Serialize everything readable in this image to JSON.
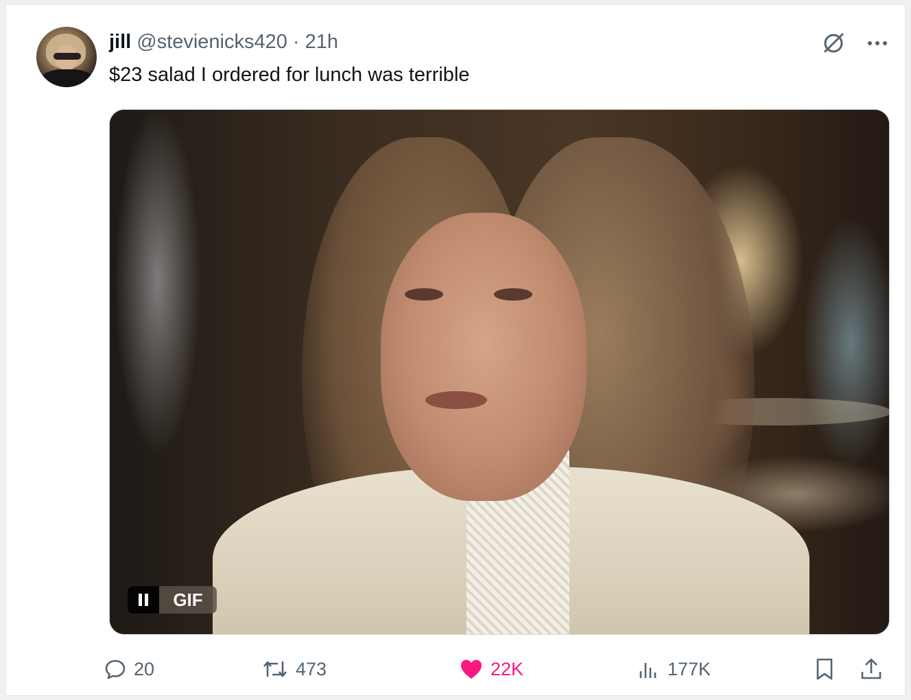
{
  "post": {
    "author_name": "jill",
    "author_handle": "@stevienicks420",
    "separator": "·",
    "time": "21h",
    "text": "$23 salad I ordered for lunch was terrible"
  },
  "media": {
    "badge_label": "GIF",
    "pause_icon": "pause-icon"
  },
  "actions": {
    "replies": "20",
    "reposts": "473",
    "likes": "22K",
    "views": "177K"
  },
  "colors": {
    "like": "#f91880",
    "muted": "#536471",
    "text": "#0f1419"
  }
}
